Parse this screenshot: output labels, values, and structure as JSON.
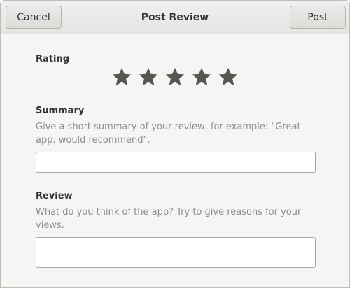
{
  "header": {
    "title": "Post Review",
    "cancel_label": "Cancel",
    "post_label": "Post"
  },
  "rating": {
    "label": "Rating",
    "value": 5,
    "max": 5,
    "star_color": "#555753"
  },
  "summary": {
    "label": "Summary",
    "hint": "Give a short summary of your review, for example: \"Great app, would recommend\".",
    "value": "",
    "placeholder": ""
  },
  "review": {
    "label": "Review",
    "hint": "What do you think of the app? Try to give reasons for your views.",
    "value": "",
    "placeholder": ""
  }
}
